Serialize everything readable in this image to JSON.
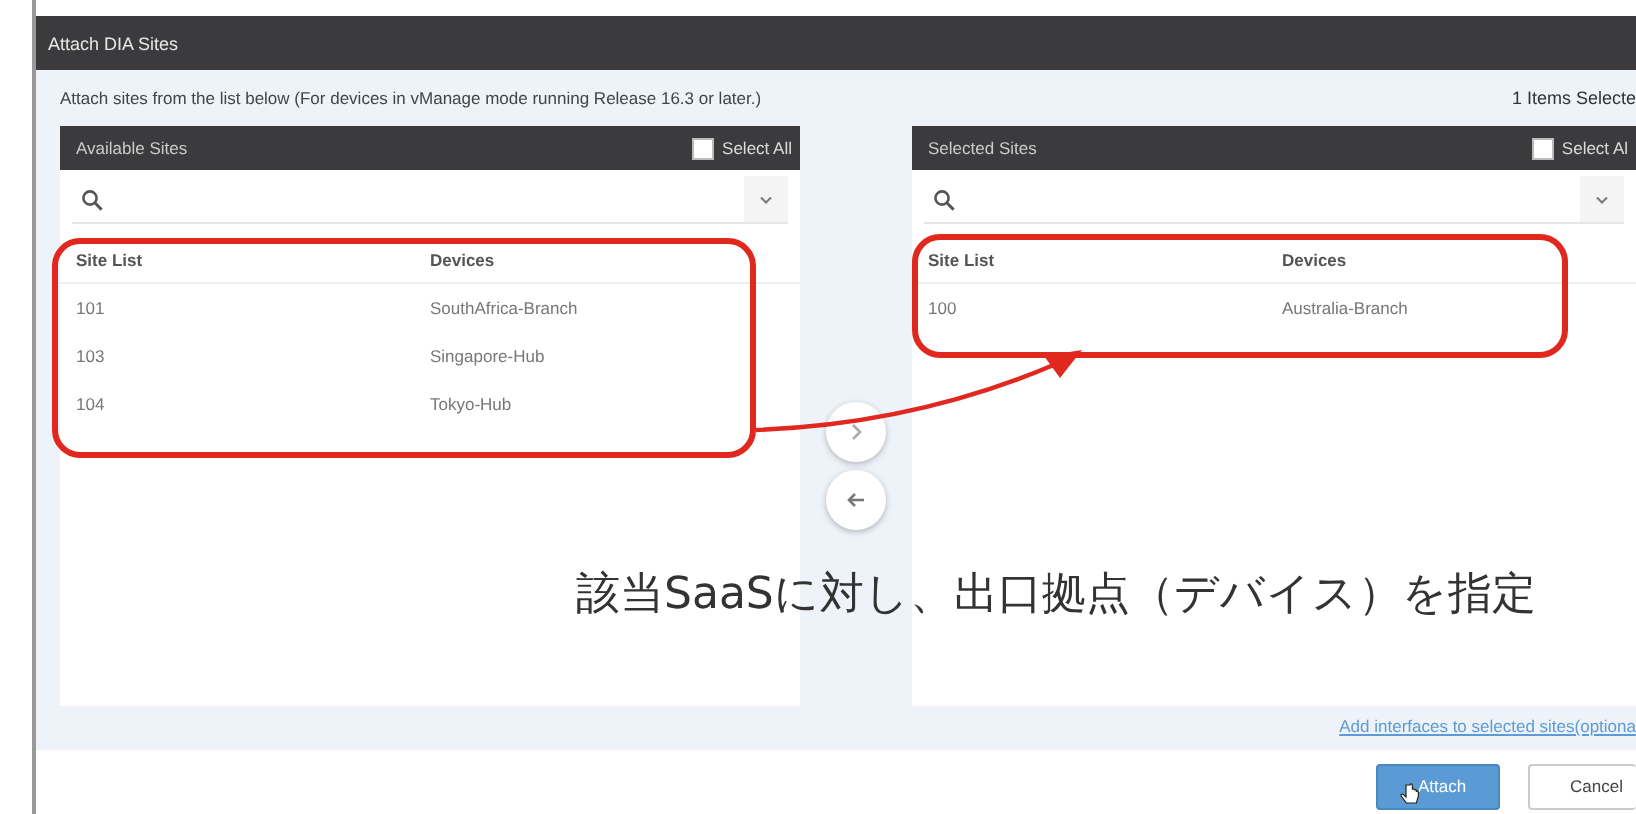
{
  "dialog": {
    "title": "Attach DIA Sites",
    "instruction": "Attach sites from the list below (For devices in vManage mode running Release 16.3 or later.)",
    "selection_count": "1 Items Selecte",
    "panels": [
      {
        "title": "Available Sites",
        "select_all": {
          "label": "Select All",
          "checked": false
        },
        "columns": [
          "Site List",
          "Devices"
        ],
        "rows": [
          [
            "101",
            "SouthAfrica-Branch"
          ],
          [
            "103",
            "Singapore-Hub"
          ],
          [
            "104",
            "Tokyo-Hub"
          ]
        ]
      },
      {
        "title": "Selected Sites",
        "select_all": {
          "label": "Select Al",
          "checked": false
        },
        "columns": [
          "Site List",
          "Devices"
        ],
        "rows": [
          [
            "100",
            "Australia-Branch"
          ]
        ]
      }
    ],
    "move_buttons": [
      {
        "kind": "right"
      },
      {
        "kind": "left"
      }
    ],
    "link": "Add interfaces to selected sites(optiona",
    "buttons": [
      {
        "label": "Attach",
        "kind": "primary"
      },
      {
        "label": "Cancel",
        "kind": "secondary"
      }
    ]
  },
  "annotation": {
    "caption": "該当SaaSに対し、出口拠点（デバイス）を指定"
  }
}
